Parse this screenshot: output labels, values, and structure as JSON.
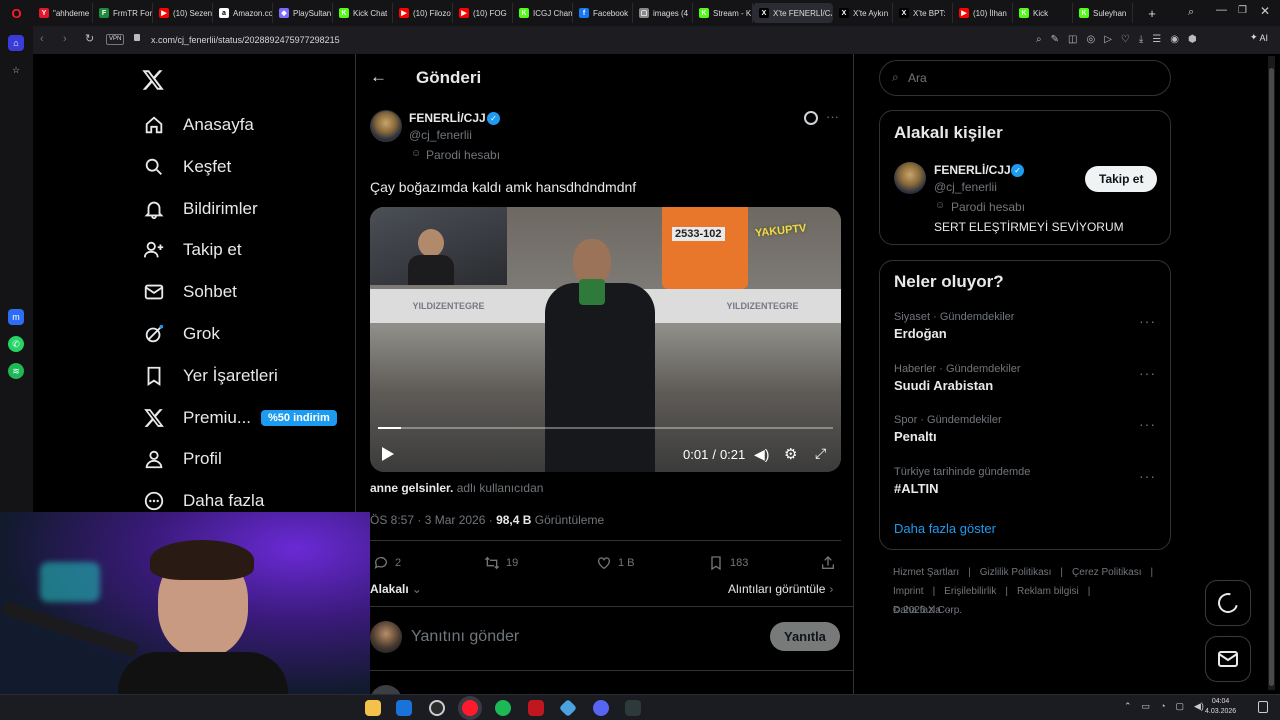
{
  "browser": {
    "tabs": [
      {
        "label": "\"ahhdeme",
        "color": "#e0182e",
        "glyph": "Y"
      },
      {
        "label": "FrmTR For",
        "color": "#1e8a3c",
        "glyph": "F"
      },
      {
        "label": "(10) Sezen",
        "color": "#ff0000",
        "glyph": "▶"
      },
      {
        "label": "Amazon.co",
        "color": "#ffffff",
        "glyph": "a"
      },
      {
        "label": "PlaySultan",
        "color": "#7b6cff",
        "glyph": "◆"
      },
      {
        "label": "Kick Chat",
        "color": "#53fc18",
        "glyph": "K"
      },
      {
        "label": "(10) Filozo",
        "color": "#ff0000",
        "glyph": "▶"
      },
      {
        "label": "(10) FOG",
        "color": "#ff0000",
        "glyph": "▶"
      },
      {
        "label": "ICGJ Chan",
        "color": "#53fc18",
        "glyph": "K"
      },
      {
        "label": "Facebook",
        "color": "#1877f2",
        "glyph": "f"
      },
      {
        "label": "images (4",
        "color": "#888888",
        "glyph": "▢"
      },
      {
        "label": "Stream - K",
        "color": "#53fc18",
        "glyph": "K"
      },
      {
        "label": "X'te FENERLİ/CJJ",
        "color": "#000000",
        "glyph": "X",
        "active": true
      },
      {
        "label": "X'te Aykın",
        "color": "#000000",
        "glyph": "X"
      },
      {
        "label": "X'te BPT:",
        "color": "#000000",
        "glyph": "X"
      },
      {
        "label": "(10) İlhan",
        "color": "#ff0000",
        "glyph": "▶"
      },
      {
        "label": "Kick",
        "color": "#53fc18",
        "glyph": "K"
      },
      {
        "label": "Suleyhan",
        "color": "#53fc18",
        "glyph": "K"
      }
    ],
    "new_tab": "+",
    "vpn_label": "VPN",
    "url": "x.com/cj_fenerlii/status/2028892475977298215",
    "ai_label": "AI"
  },
  "left_nav": {
    "items": [
      {
        "label": "Anasayfa",
        "icon": "home-icon"
      },
      {
        "label": "Keşfet",
        "icon": "search-icon"
      },
      {
        "label": "Bildirimler",
        "icon": "bell-icon"
      },
      {
        "label": "Takip et",
        "icon": "follow-icon"
      },
      {
        "label": "Sohbet",
        "icon": "mail-icon"
      },
      {
        "label": "Grok",
        "icon": "grok-icon"
      },
      {
        "label": "Yer İşaretleri",
        "icon": "bookmark-icon"
      },
      {
        "label": "Premiu...",
        "icon": "x-logo-icon"
      },
      {
        "label": "Profil",
        "icon": "person-icon"
      },
      {
        "label": "Daha fazla",
        "icon": "more-circle-icon"
      }
    ],
    "premium_badge": "%50 indirim"
  },
  "post": {
    "header_title": "Gönderi",
    "author_name": "FENERLİ/CJJ",
    "author_handle": "@cj_fenerlii",
    "parody_label": "Parodi hesabı",
    "text": "Çay boğazımda kaldı amk hansdhdndmdnf",
    "video": {
      "time_current": "0:01",
      "time_sep": "/",
      "time_total": "0:21",
      "progress": 0.05,
      "overlay_logo": "YAKUPTV",
      "sponsor_text": "YILDIZENTEGRE",
      "bib_number": "2533-102"
    },
    "source_user": "anne gelsinler.",
    "source_suffix": "adlı kullanıcıdan",
    "timestamp": "ÖS 8:57 · 3 Mar 2026 ·",
    "views_count": "98,4 B",
    "views_label": "Görüntüleme",
    "replies": "2",
    "reposts": "19",
    "likes": "1 B",
    "bookmarks": "183",
    "relevance_label": "Alakalı",
    "quotes_label": "Alıntıları görüntüle",
    "reply_placeholder": "Yanıtını gönder",
    "reply_button": "Yanıtla"
  },
  "right": {
    "search_placeholder": "Ara",
    "related_title": "Alakalı kişiler",
    "related_name": "FENERLİ/CJJ",
    "related_handle": "@cj_fenerlii",
    "related_parody": "Parodi hesabı",
    "related_bio": "SERT ELEŞTİRMEYİ SEVİYORUM",
    "follow_button": "Takip et",
    "trends_title": "Neler oluyor?",
    "trends": [
      {
        "category": "Siyaset · Gündemdekiler",
        "title": "Erdoğan"
      },
      {
        "category": "Haberler · Gündemdekiler",
        "title": "Suudi Arabistan"
      },
      {
        "category": "Spor · Gündemdekiler",
        "title": "Penaltı"
      },
      {
        "category": "Türkiye tarihinde gündemde",
        "title": "#ALTIN"
      }
    ],
    "show_more": "Daha fazla göster",
    "footer": [
      "Hizmet Şartları",
      "|",
      "Gizlilik Politikası",
      "|",
      "Çerez Politikası",
      "|",
      "Imprint",
      "|",
      "Erişilebilirlik",
      "|",
      "Reklam bilgisi",
      "|",
      "Daha fazla ···"
    ],
    "copyright": "© 2026 X Corp."
  },
  "system": {
    "time": "04:04",
    "date": "4.03.2026"
  },
  "colors": {
    "accent": "#1d9bf0",
    "verified": "#1d9bf0",
    "background": "#000000",
    "border": "#2f3336",
    "muted": "#71767b"
  }
}
